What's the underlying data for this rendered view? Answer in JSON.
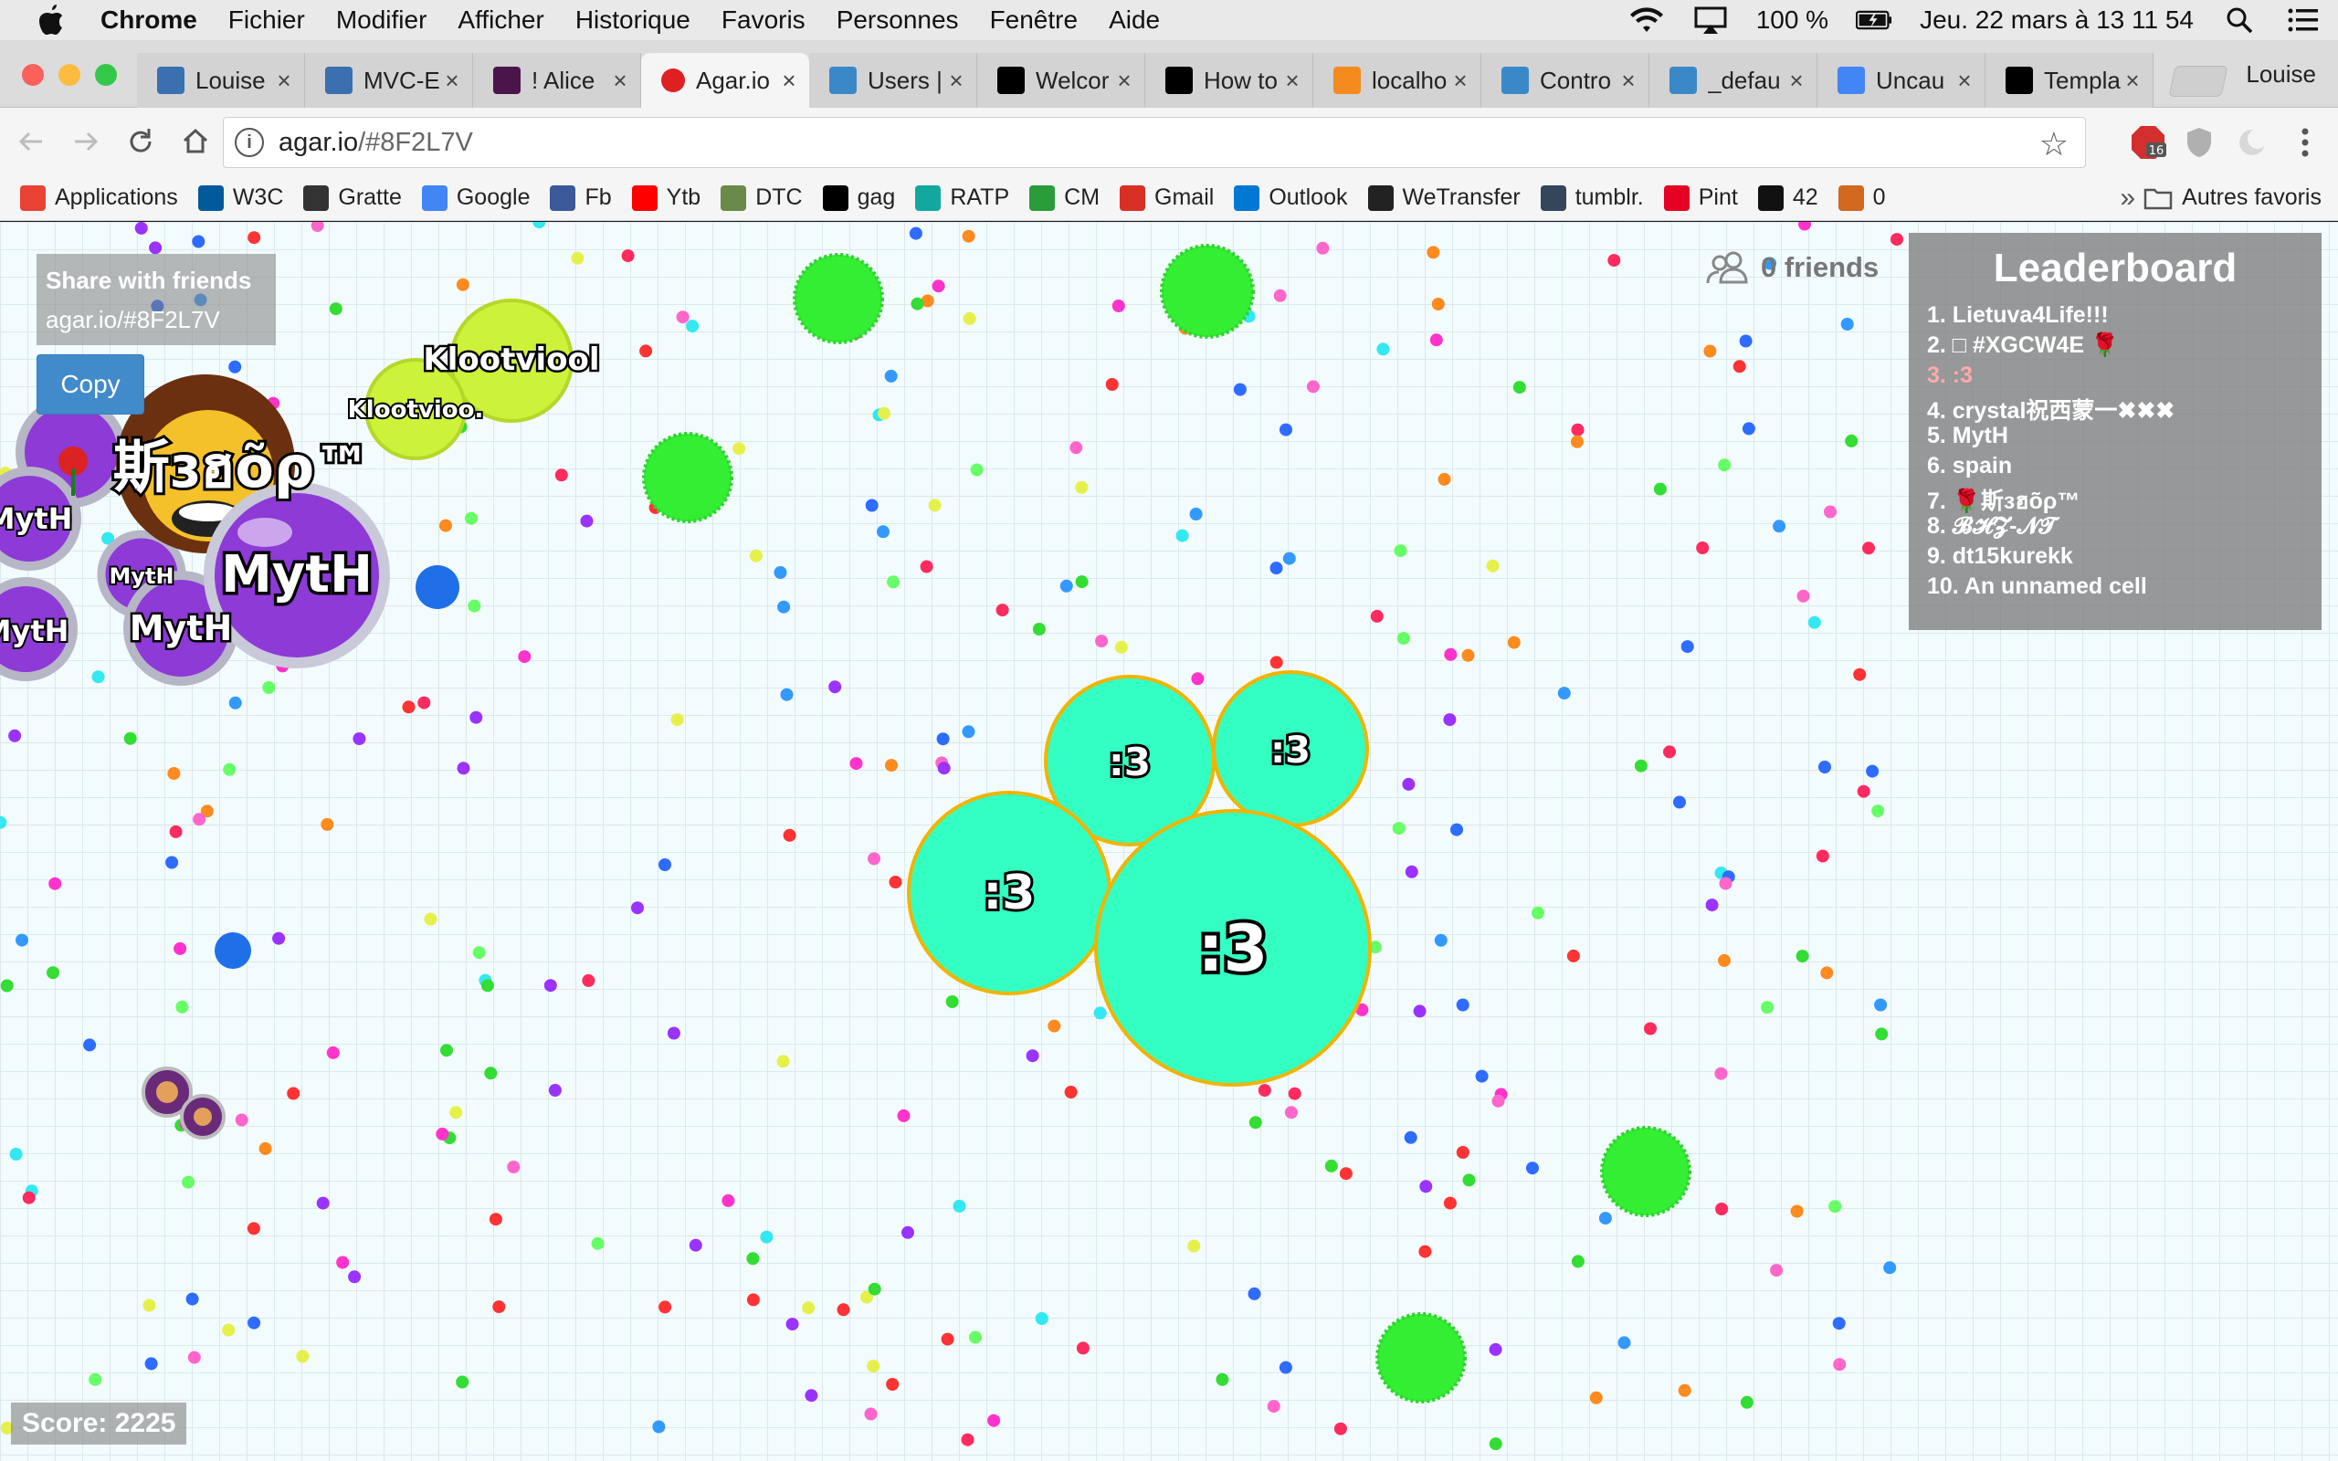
{
  "menubar": {
    "app": "Chrome",
    "items": [
      "Fichier",
      "Modifier",
      "Afficher",
      "Historique",
      "Favoris",
      "Personnes",
      "Fenêtre",
      "Aide"
    ],
    "battery": "100 %",
    "datetime": "Jeu. 22 mars à  13 11 54"
  },
  "tabs": [
    {
      "label": "Louise",
      "icon": "curly-braces-icon",
      "color": "#3a6fb0"
    },
    {
      "label": "MVC-E",
      "icon": "curly-braces-icon",
      "color": "#3a6fb0"
    },
    {
      "label": "! Alice",
      "icon": "slack-hash-icon",
      "color": "#4a154b"
    },
    {
      "label": "Agar.io",
      "icon": "agar-icon",
      "color": "#e02020"
    },
    {
      "label": "Users |",
      "icon": "bird-icon",
      "color": "#3a88c8"
    },
    {
      "label": "Welcor",
      "icon": "symfony-icon",
      "color": "#000000"
    },
    {
      "label": "How to",
      "icon": "symfony-icon",
      "color": "#000000"
    },
    {
      "label": "localho",
      "icon": "pma-icon",
      "color": "#f58b1e"
    },
    {
      "label": "Contro",
      "icon": "bird-icon",
      "color": "#3a88c8"
    },
    {
      "label": "_defau",
      "icon": "bird-icon",
      "color": "#3a88c8"
    },
    {
      "label": "Uncau",
      "icon": "google-icon",
      "color": "#4285f4"
    },
    {
      "label": "Templa",
      "icon": "symfony-icon",
      "color": "#000000"
    }
  ],
  "profile": "Louise",
  "address": {
    "host": "agar.io",
    "path": "/#8F2L7V"
  },
  "extension_badge": "16",
  "bookmarks": [
    {
      "label": "Applications",
      "icon": "apps-grid-icon",
      "color": "#e94235"
    },
    {
      "label": "W3C",
      "icon": "w3c-icon",
      "color": "#005a9c"
    },
    {
      "label": "Gratte",
      "icon": "gratte-icon",
      "color": "#333333"
    },
    {
      "label": "Google",
      "icon": "google-icon",
      "color": "#4285f4"
    },
    {
      "label": "Fb",
      "icon": "facebook-icon",
      "color": "#3b5998"
    },
    {
      "label": "Ytb",
      "icon": "youtube-icon",
      "color": "#ff0000"
    },
    {
      "label": "DTC",
      "icon": "dtc-icon",
      "color": "#6a8a4a"
    },
    {
      "label": "gag",
      "icon": "9gag-icon",
      "color": "#000000"
    },
    {
      "label": "RATP",
      "icon": "ratp-icon",
      "color": "#13a89e"
    },
    {
      "label": "CM",
      "icon": "cm-icon",
      "color": "#2a9d3a"
    },
    {
      "label": "Gmail",
      "icon": "gmail-icon",
      "color": "#d93025"
    },
    {
      "label": "Outlook",
      "icon": "microsoft-icon",
      "color": "#0078d4"
    },
    {
      "label": "WeTransfer",
      "icon": "wetransfer-icon",
      "color": "#222222"
    },
    {
      "label": "tumblr.",
      "icon": "tumblr-icon",
      "color": "#35465c"
    },
    {
      "label": "Pint",
      "icon": "pinterest-icon",
      "color": "#e60023"
    },
    {
      "label": "42",
      "icon": "42-icon",
      "color": "#111111"
    },
    {
      "label": "0",
      "icon": "cookie-icon",
      "color": "#d2691e"
    }
  ],
  "bookmarks_other": "Autres favoris",
  "share": {
    "title": "Share with friends",
    "link": "agar.io/#8F2L7V",
    "copy": "Copy"
  },
  "friends": "0 friends",
  "leaderboard": {
    "title": "Leaderboard",
    "rows": [
      "1. Lietuva4Life!!!",
      "2. □ #XGCW4E 🌹",
      "3. :3",
      "4. crystal祝西蒙一✖✖✖",
      "5. MytH",
      "6. spain",
      "7. 🌹斯ɜฮõρ™",
      "8. 𝓑𝓗𝓩-𝓝𝓣",
      "9. dt15kurekk",
      "10. An unnamed cell"
    ]
  },
  "cells": {
    "player_label": ":3",
    "myth_label": "MytH",
    "kloot_label": "Klootviool",
    "kloot_small_label": "Klootvioo.",
    "sino_label": "斯ɜฮõρ™"
  },
  "score": "Score: 2225",
  "colors": {
    "player_fill": "#33ffc3",
    "player_stroke": "#f0b400",
    "virus": "#33ff33",
    "kloot": "#ccf23a",
    "myth": "#9c33d8"
  }
}
